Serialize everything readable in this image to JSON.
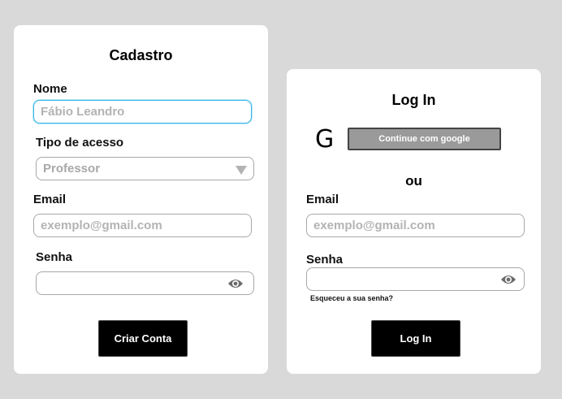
{
  "signup": {
    "title": "Cadastro",
    "name_label": "Nome",
    "name_placeholder": "Fábio Leandro",
    "access_label": "Tipo de acesso",
    "access_value": "Professor",
    "email_label": "Email",
    "email_placeholder": "exemplo@gmail.com",
    "password_label": "Senha",
    "submit_label": "Criar Conta"
  },
  "login": {
    "title": "Log In",
    "google_label": "Continue com google",
    "google_glyph": "G",
    "or_text": "ou",
    "email_label": "Email",
    "email_placeholder": "exemplo@gmail.com",
    "password_label": "Senha",
    "forgot_label": "Esqueceu a sua senha?",
    "submit_label": "Log In"
  },
  "colors": {
    "background": "#d9d9d9",
    "card": "#ffffff",
    "focus_border": "#33b5e5",
    "button": "#000000",
    "google_button": "#9a9a9a"
  }
}
